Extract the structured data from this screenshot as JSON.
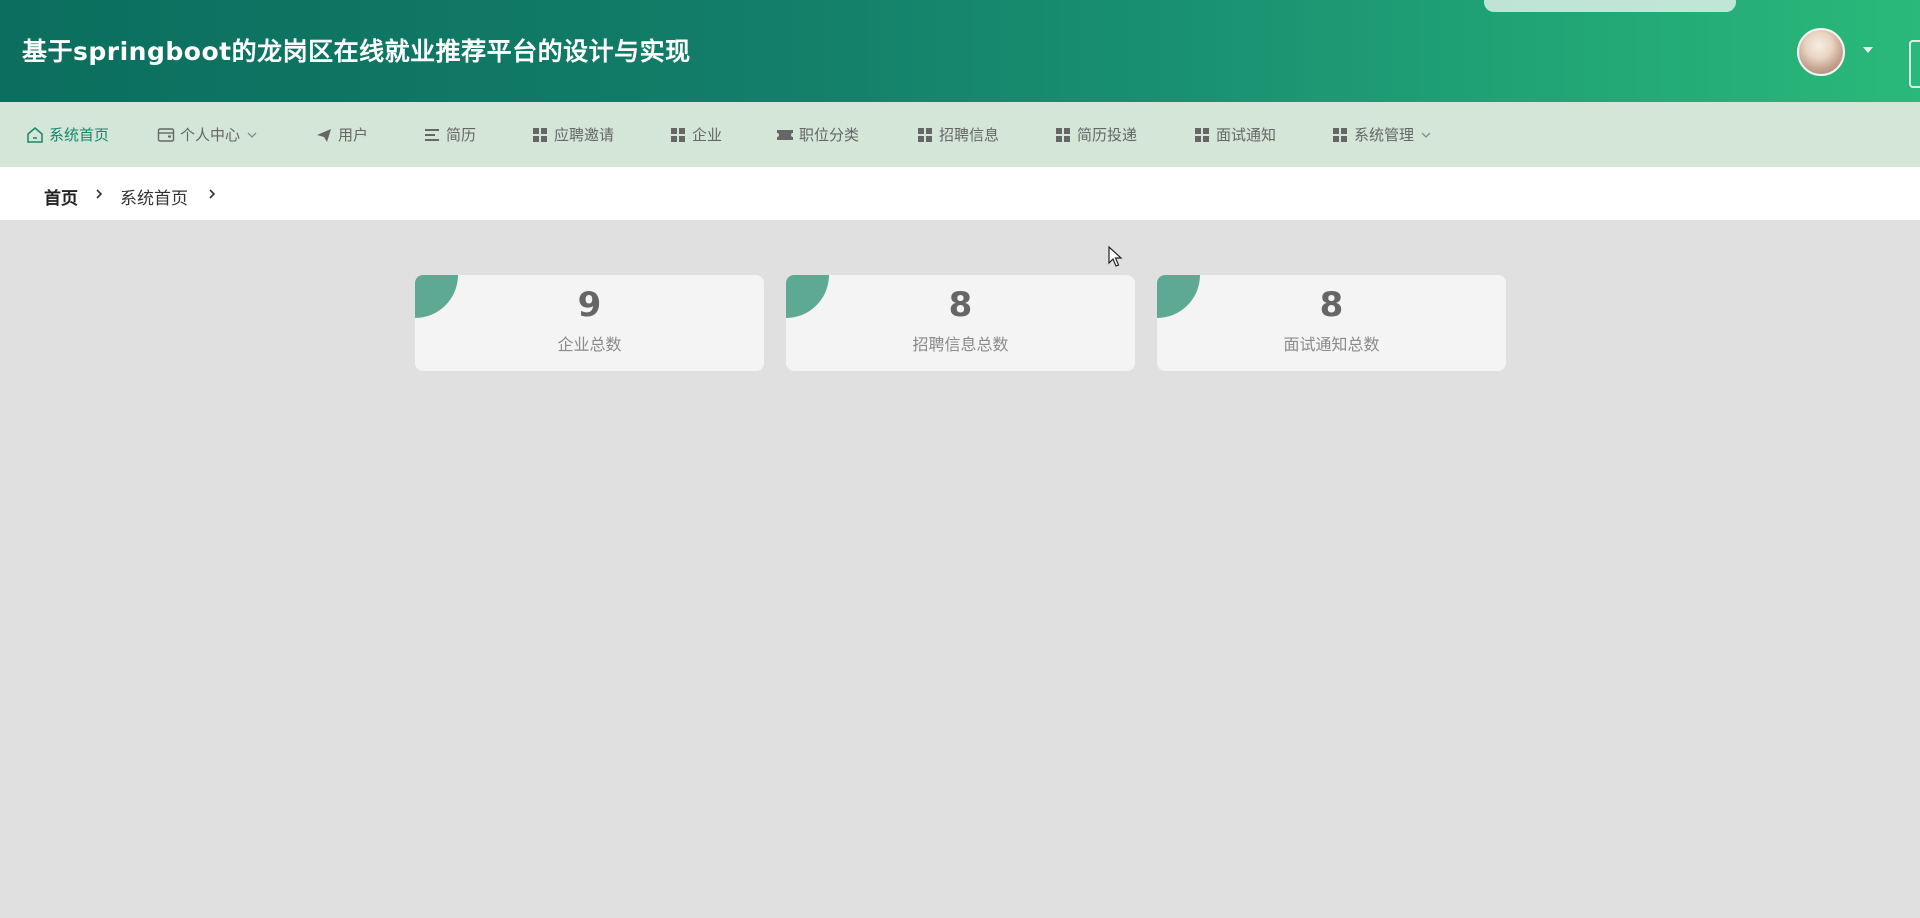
{
  "header": {
    "title": "基于springboot的龙岗区在线就业推荐平台的设计与实现",
    "avatar_icon": "user-avatar",
    "menu_caret_icon": "caret-down-icon"
  },
  "nav": {
    "items": [
      {
        "label": "系统首页",
        "icon": "home-icon",
        "active": true
      },
      {
        "label": "个人中心",
        "icon": "wallet-icon",
        "dropdown": true
      },
      {
        "label": "用户",
        "icon": "send-icon"
      },
      {
        "label": "简历",
        "icon": "list-icon"
      },
      {
        "label": "应聘邀请",
        "icon": "grid-icon"
      },
      {
        "label": "企业",
        "icon": "grid-icon"
      },
      {
        "label": "职位分类",
        "icon": "ticket-icon"
      },
      {
        "label": "招聘信息",
        "icon": "grid-icon"
      },
      {
        "label": "简历投递",
        "icon": "grid-icon"
      },
      {
        "label": "面试通知",
        "icon": "grid-icon"
      },
      {
        "label": "系统管理",
        "icon": "grid-icon",
        "dropdown": true
      }
    ]
  },
  "breadcrumb": {
    "home": "首页",
    "current": "系统首页"
  },
  "stats": [
    {
      "value": "9",
      "label": "企业总数"
    },
    {
      "value": "8",
      "label": "招聘信息总数"
    },
    {
      "value": "8",
      "label": "面试通知总数"
    }
  ],
  "colors": {
    "accent": "#16876d",
    "card_corner": "#5ea994",
    "nav_bg": "#d4e6d8"
  }
}
